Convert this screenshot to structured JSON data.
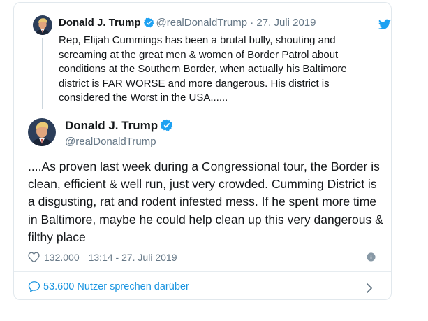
{
  "quoted_tweet": {
    "name": "Donald J. Trump",
    "handle": "@realDonaldTrump",
    "separator": "·",
    "date": "27. Juli 2019",
    "text": "Rep, Elijah Cummings has been a brutal bully, shouting and screaming at the great men & women of Border Patrol about conditions at the Southern Border, when actually his Baltimore district is FAR WORSE and more dangerous. His district is considered the Worst in the USA......"
  },
  "tweet": {
    "name": "Donald J. Trump",
    "handle": "@realDonaldTrump",
    "text": "....As proven last week during a Congressional tour, the Border is clean, efficient & well run, just very crowded. Cumming District is a disgusting, rat and rodent infested mess. If he spent more time in Baltimore, maybe he could help clean up this very dangerous & filthy place",
    "likes": "132.000",
    "timestamp": "13:14 - 27. Juli 2019"
  },
  "conversation": {
    "label": "53.600 Nutzer sprechen darüber"
  },
  "colors": {
    "accent": "#1da1f2",
    "link": "#1b95e0",
    "secondary_text": "#657786",
    "border": "#e1e8ed"
  },
  "icons": [
    "twitter-bird-icon",
    "verified-badge-icon",
    "heart-icon",
    "info-icon",
    "speech-bubble-icon",
    "chevron-right-icon"
  ]
}
